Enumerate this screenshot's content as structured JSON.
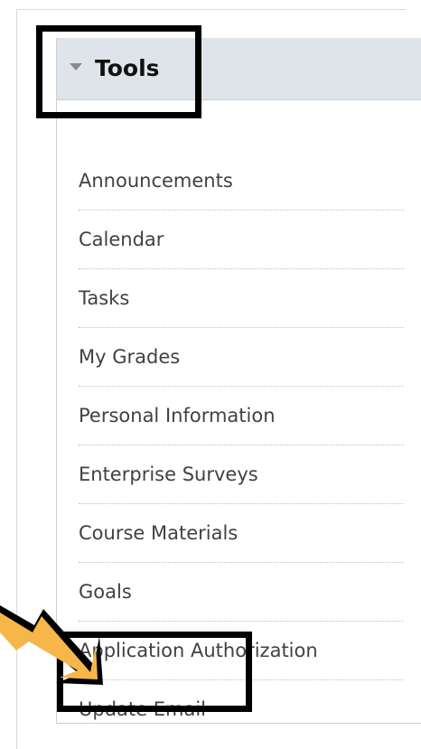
{
  "tools_panel": {
    "title": "Tools",
    "items": [
      {
        "label": "Announcements"
      },
      {
        "label": "Calendar"
      },
      {
        "label": "Tasks"
      },
      {
        "label": "My Grades"
      },
      {
        "label": "Personal Information"
      },
      {
        "label": "Enterprise Surveys"
      },
      {
        "label": "Course Materials"
      },
      {
        "label": "Goals"
      },
      {
        "label": "Application Authorization"
      },
      {
        "label": "Update Email"
      }
    ]
  },
  "colors": {
    "header_bg": "#dfe4ea",
    "item_text": "#3f4145",
    "annotation_arrow": "#f7b64a",
    "annotation_box": "#000000"
  },
  "icons": {
    "collapse": "triangle-down-icon",
    "annotation": "arrow-icon"
  }
}
